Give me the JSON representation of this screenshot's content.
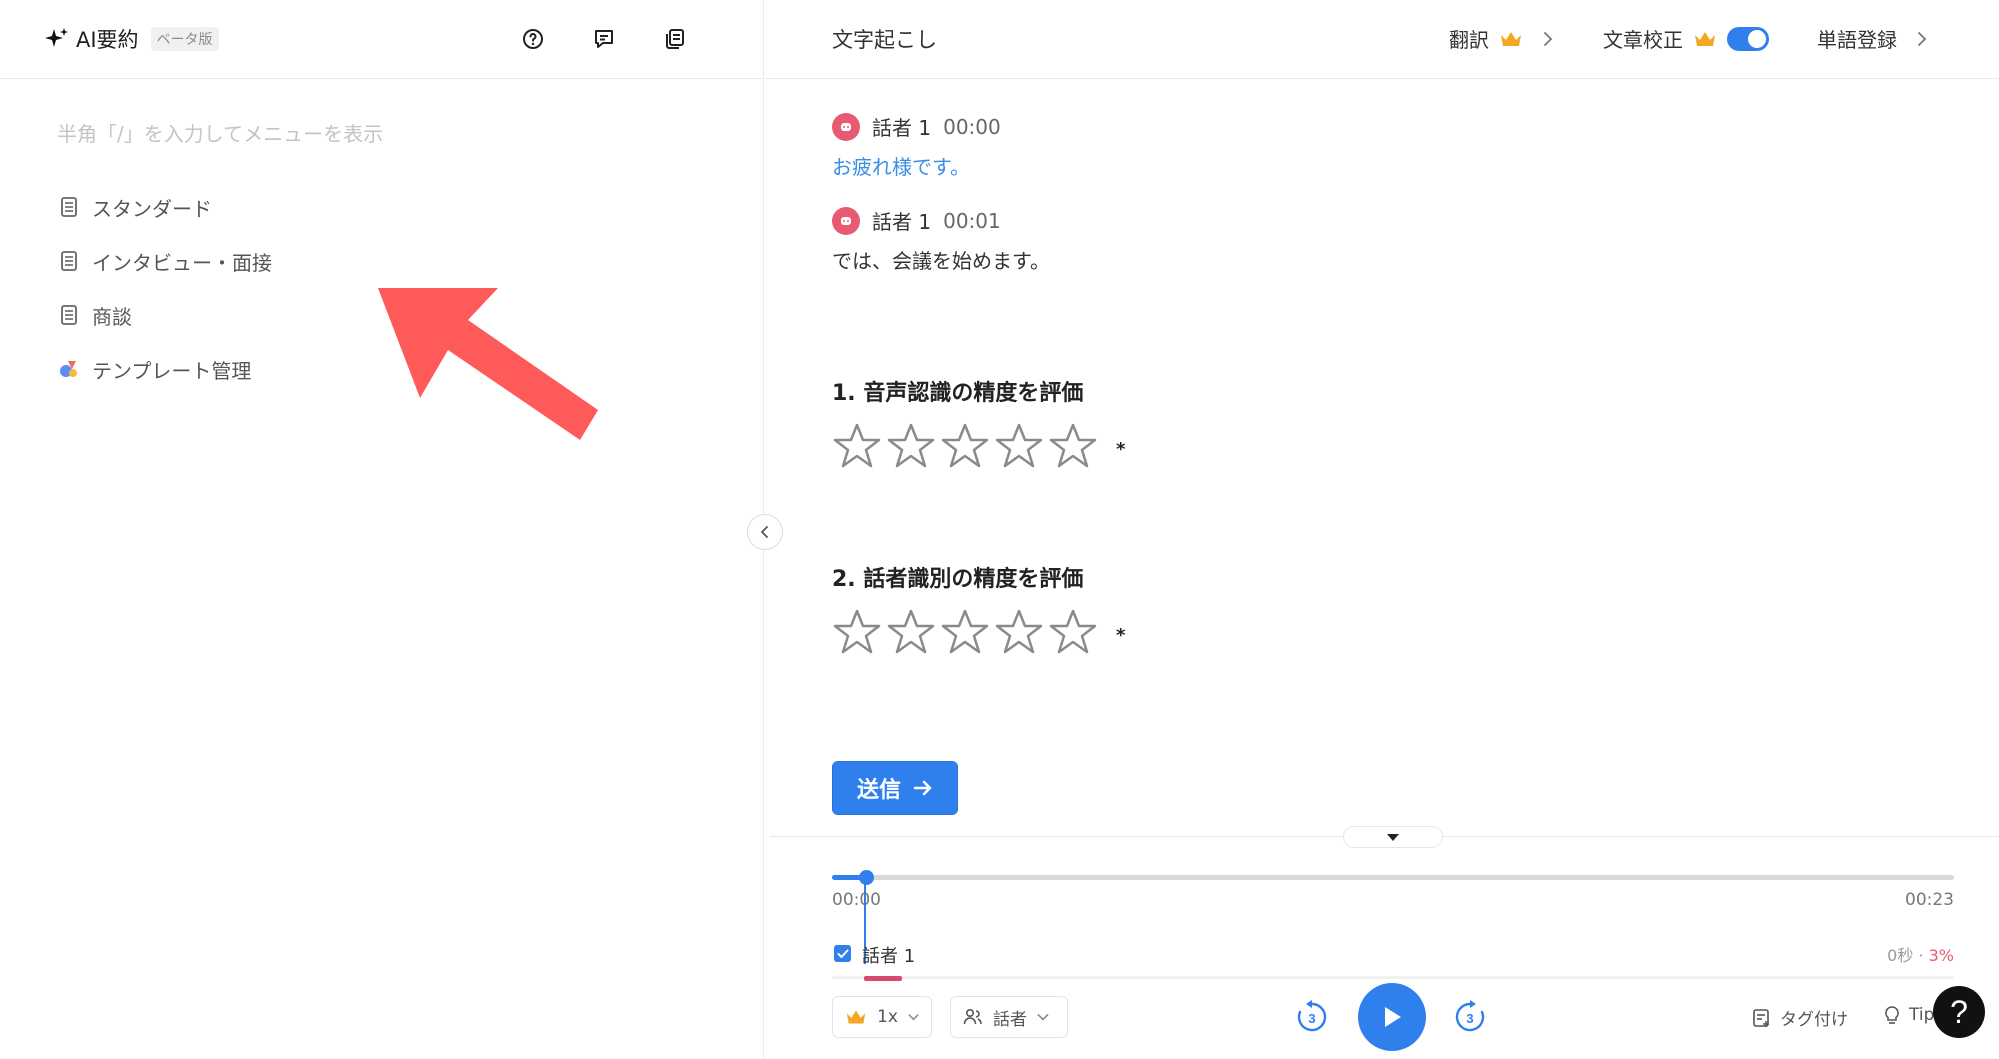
{
  "left": {
    "brand": {
      "title": "AI要約",
      "badge": "ベータ版"
    },
    "header_icons": [
      "help-circle-icon",
      "feedback-icon",
      "copy-icon"
    ],
    "placeholder": "半角「/」を入力してメニューを表示",
    "templates": [
      {
        "label": "スタンダード",
        "icon": "document-icon"
      },
      {
        "label": "インタビュー・面接",
        "icon": "document-icon"
      },
      {
        "label": "商談",
        "icon": "document-icon"
      },
      {
        "label": "テンプレート管理",
        "icon": "template-manage-icon"
      }
    ],
    "annotation": {
      "color": "#ff5a5a"
    }
  },
  "right": {
    "header": {
      "title": "文字起こし",
      "translate": "翻訳",
      "proofread": "文章校正",
      "proofread_on": true,
      "dictionary": "単語登録"
    },
    "transcript": [
      {
        "speaker": "話者 1",
        "time": "00:00",
        "text": "お疲れ様です。",
        "active": true
      },
      {
        "speaker": "話者 1",
        "time": "00:01",
        "text": "では、会議を始めます。",
        "active": false
      }
    ],
    "ratings": [
      {
        "title": "1. 音声認識の精度を評価",
        "stars": 5,
        "required_mark": "*"
      },
      {
        "title": "2. 話者識別の精度を評価",
        "stars": 5,
        "required_mark": "*"
      }
    ],
    "submit_label": "送信",
    "player": {
      "current_time": "00:00",
      "total_time": "00:23",
      "progress": 0.03,
      "speaker": {
        "name": "話者 1",
        "duration": "0秒",
        "sep": "·",
        "percent": "3%"
      },
      "speed": "1x",
      "speaker_filter": "話者",
      "skip_back": "3",
      "skip_forward": "3",
      "tag_label": "タグ付け",
      "tips_label": "Tips",
      "help_label": "?"
    },
    "colors": {
      "accent": "#2f80ed",
      "speaker": "#e85a72"
    }
  }
}
